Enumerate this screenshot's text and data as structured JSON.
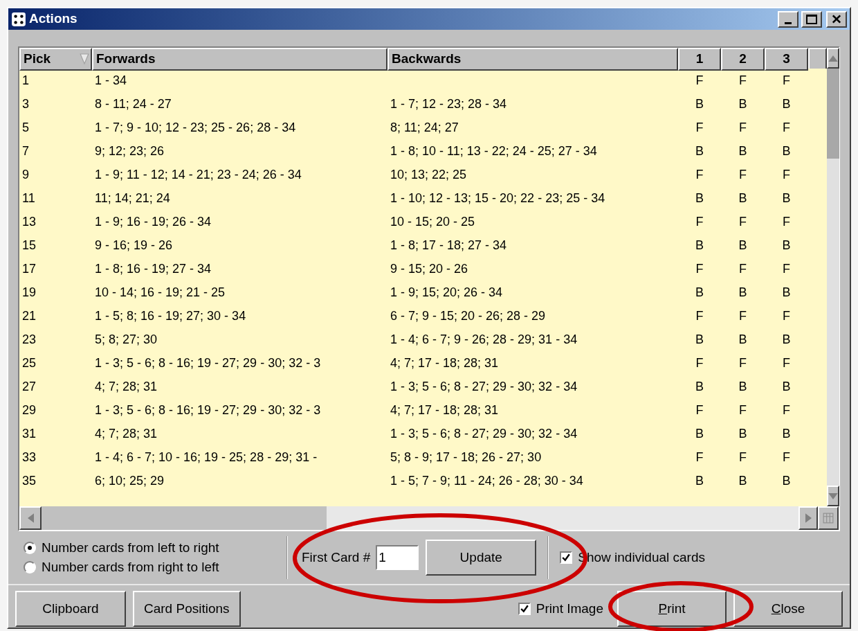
{
  "window": {
    "title": "Actions"
  },
  "table": {
    "columns": [
      {
        "label": "Pick",
        "sorted": true
      },
      {
        "label": "Forwards",
        "sorted": false
      },
      {
        "label": "Backwards",
        "sorted": false
      },
      {
        "label": "1",
        "sorted": false
      },
      {
        "label": "2",
        "sorted": false
      },
      {
        "label": "3",
        "sorted": false
      }
    ],
    "rows": [
      {
        "pick": "1",
        "forwards": "1 - 34",
        "c1": "F",
        "c2": "F",
        "c3": "F"
      },
      {
        "pick": "3",
        "forwards": "8 - 11; 24 - 27",
        "backwards": "1 - 7; 12 - 23; 28 - 34",
        "c1": "B",
        "c2": "B",
        "c3": "B"
      },
      {
        "pick": "5",
        "forwards": "1 - 7; 9 - 10; 12 - 23; 25 - 26; 28 - 34",
        "backwards": "8; 11; 24; 27",
        "c1": "F",
        "c2": "F",
        "c3": "F"
      },
      {
        "pick": "7",
        "forwards": "9; 12; 23; 26",
        "backwards": "1 - 8; 10 - 11; 13 - 22; 24 - 25; 27 - 34",
        "c1": "B",
        "c2": "B",
        "c3": "B"
      },
      {
        "pick": "9",
        "forwards": "1 - 9; 11 - 12; 14 - 21; 23 - 24; 26 - 34",
        "backwards": "10; 13; 22; 25",
        "c1": "F",
        "c2": "F",
        "c3": "F"
      },
      {
        "pick": "11",
        "forwards": "11; 14; 21; 24",
        "backwards": "1 - 10; 12 - 13; 15 - 20; 22 - 23; 25 - 34",
        "c1": "B",
        "c2": "B",
        "c3": "B"
      },
      {
        "pick": "13",
        "forwards": "1 - 9; 16 - 19; 26 - 34",
        "backwards": "10 - 15; 20 - 25",
        "c1": "F",
        "c2": "F",
        "c3": "F"
      },
      {
        "pick": "15",
        "forwards": "9 - 16; 19 - 26",
        "backwards": "1 - 8; 17 - 18; 27 - 34",
        "c1": "B",
        "c2": "B",
        "c3": "B"
      },
      {
        "pick": "17",
        "forwards": "1 - 8; 16 - 19; 27 - 34",
        "backwards": "9 - 15; 20 - 26",
        "c1": "F",
        "c2": "F",
        "c3": "F"
      },
      {
        "pick": "19",
        "forwards": "10 - 14; 16 - 19; 21 - 25",
        "backwards": "1 - 9; 15; 20; 26 - 34",
        "c1": "B",
        "c2": "B",
        "c3": "B"
      },
      {
        "pick": "21",
        "forwards": "1 - 5; 8; 16 - 19; 27; 30 - 34",
        "backwards": "6 - 7; 9 - 15; 20 - 26; 28 - 29",
        "c1": "F",
        "c2": "F",
        "c3": "F"
      },
      {
        "pick": "23",
        "forwards": "5; 8; 27; 30",
        "backwards": "1 - 4; 6 - 7; 9 - 26; 28 - 29; 31 - 34",
        "c1": "B",
        "c2": "B",
        "c3": "B"
      },
      {
        "pick": "25",
        "forwards": "1 - 3; 5 - 6; 8 - 16; 19 - 27; 29 - 30; 32 - 3",
        "backwards": "4; 7; 17 - 18; 28; 31",
        "c1": "F",
        "c2": "F",
        "c3": "F"
      },
      {
        "pick": "27",
        "forwards": "4; 7; 28; 31",
        "backwards": "1 - 3; 5 - 6; 8 - 27; 29 - 30; 32 - 34",
        "c1": "B",
        "c2": "B",
        "c3": "B"
      },
      {
        "pick": "29",
        "forwards": "1 - 3; 5 - 6; 8 - 16; 19 - 27; 29 - 30; 32 - 3",
        "backwards": "4; 7; 17 - 18; 28; 31",
        "c1": "F",
        "c2": "F",
        "c3": "F"
      },
      {
        "pick": "31",
        "forwards": "4; 7; 28; 31",
        "backwards": "1 - 3; 5 - 6; 8 - 27; 29 - 30; 32 - 34",
        "c1": "B",
        "c2": "B",
        "c3": "B"
      },
      {
        "pick": "33",
        "forwards": "1 - 4; 6 - 7; 10 - 16; 19 - 25; 28 - 29; 31 -",
        "backwards": "5; 8 - 9; 17 - 18; 26 - 27; 30",
        "c1": "F",
        "c2": "F",
        "c3": "F"
      },
      {
        "pick": "35",
        "forwards": "6; 10; 25; 29",
        "backwards": "1 - 5; 7 - 9; 11 - 24; 26 - 28; 30 - 34",
        "c1": "B",
        "c2": "B",
        "c3": "B"
      }
    ]
  },
  "numbering": [
    {
      "label": "Number cards from left to right",
      "selected": true
    },
    {
      "label": "Number cards from right to left",
      "selected": false
    }
  ],
  "first_card": {
    "label": "First Card #",
    "value": "1"
  },
  "update_button": "Update",
  "show_individual_cards": {
    "label": "Show individual cards",
    "checked": true
  },
  "left_buttons": [
    "Clipboard",
    "Card Positions"
  ],
  "print_image": {
    "label": "Print Image",
    "checked": true
  },
  "right_buttons": [
    {
      "access_key": "P",
      "label_rest": "rint"
    },
    {
      "access_key": "C",
      "label_rest": "lose"
    }
  ],
  "annotations": [
    {
      "kind": "ellipse"
    },
    {
      "kind": "ellipse"
    }
  ]
}
